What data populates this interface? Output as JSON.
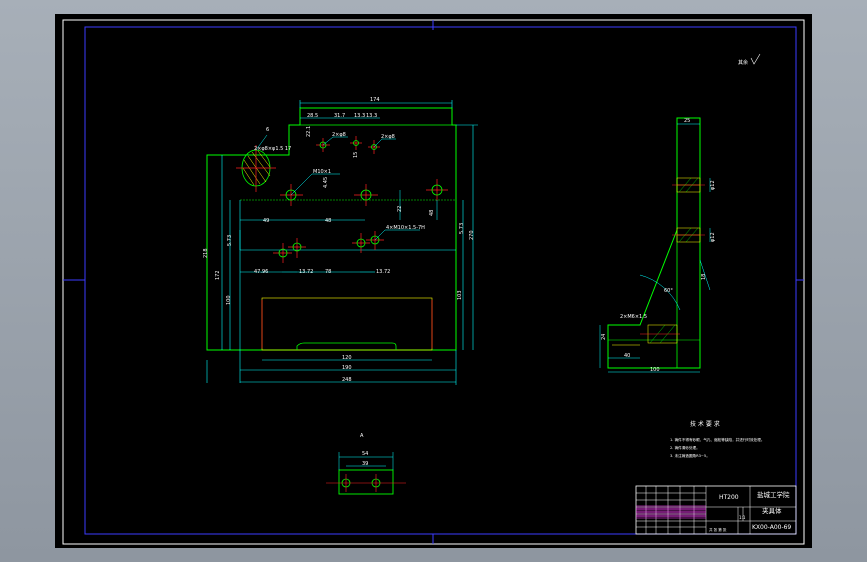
{
  "colors": {
    "background": "#000000",
    "frame": "#ffffff",
    "border": "#3c3cff",
    "part_outline": "#00ff00",
    "dimension": "#00ffff",
    "centerline": "#ff2020",
    "hidden": "#ffff00",
    "annotation": "#ff3cff"
  },
  "roughness": "其余",
  "front_view": {
    "label_6": "6",
    "dims": {
      "d174": "174",
      "d28_5": "28.5",
      "d31_7": "31.7",
      "d13_3": "13.3",
      "d13_3b": "13.3",
      "d22_1": "22.1",
      "d4_45": "4.45",
      "d15": "15",
      "d49": "49",
      "d48": "48",
      "d22": "22",
      "d48b": "48",
      "d5_73": "5.73",
      "d5_73b": "5.73",
      "d47_96": "47.96",
      "d13_72": "13.72",
      "d78": "78",
      "d13_72b": "13.72",
      "d172": "172",
      "d218": "218",
      "d270": "270",
      "d103": "103",
      "d100": "100",
      "d120": "120",
      "d190": "190",
      "d248": "248"
    },
    "callouts": {
      "hole1": "2×φ8",
      "hole2": "2×φ8",
      "hole3": "M10×1",
      "hole4": "4×M10×1.5-7H",
      "hole5": "2×φ8×φ1.5 17"
    }
  },
  "side_view": {
    "dims": {
      "d25": "25",
      "d12": "φ12",
      "d32": "φ12",
      "d40": "40",
      "d60": "60",
      "d18": "18",
      "d100": "100",
      "d24": "24",
      "angle": "60°",
      "callout": "2×M6×1.5"
    }
  },
  "detail_view": {
    "label": "A",
    "dims": {
      "d54": "54",
      "d39": "39"
    }
  },
  "notes": {
    "heading": "技 术 要 求",
    "lines": [
      "1. 铸件不得有砂眼、气孔、缩松等缺陷，并进行时效处理。",
      "2. 铸件清砂处理。",
      "3. 未注铸造圆角R3~5。"
    ]
  },
  "title_block": {
    "material": "HT200",
    "school": "盐城工学院",
    "part_name": "夹具体",
    "drawing_no": "KX00-A00-69",
    "scale": "1:1",
    "sheet": "共 张 第 张"
  }
}
